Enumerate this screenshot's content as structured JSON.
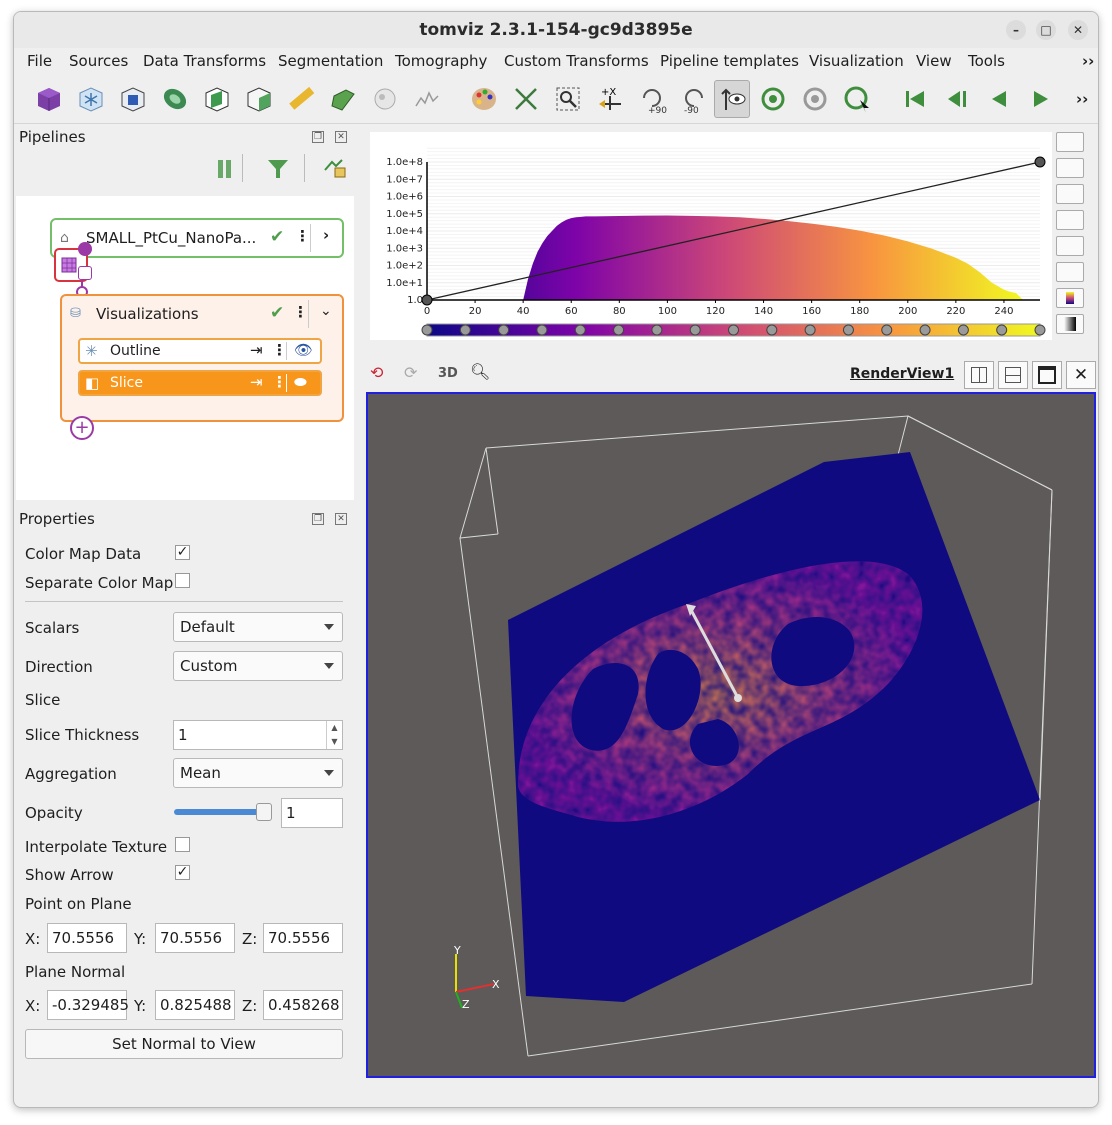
{
  "window": {
    "title": "tomviz 2.3.1-154-gc9d3895e"
  },
  "menu": [
    "File",
    "Sources",
    "Data Transforms",
    "Segmentation",
    "Tomography",
    "Custom Transforms",
    "Pipeline templates",
    "Visualization",
    "View",
    "Tools"
  ],
  "toolbar_icons": [
    "cube-icon",
    "snowflake-icon",
    "box-icon",
    "contour-icon",
    "slice-box-icon",
    "open-box-icon",
    "ruler-icon",
    "clip-icon",
    "sphere-icon",
    "line-plot-icon",
    "palette-icon",
    "fit-icon",
    "zoom-box-icon",
    "axis-x-icon",
    "rotate-cw-icon",
    "rotate-ccw-icon",
    "interact-icon",
    "reset-icon",
    "center-icon",
    "pick-icon",
    "first-frame-icon",
    "prev-frame-icon",
    "play-back-icon",
    "play-icon"
  ],
  "toolbar_labels": {
    "rot_pos": "+90",
    "rot_neg": "-90",
    "axis": "+X"
  },
  "pipelines": {
    "title": "Pipelines",
    "data_source": "SMALL_PtCu_NanoPa...",
    "visualizations_label": "Visualizations",
    "modules": [
      {
        "label": "Outline",
        "selected": false
      },
      {
        "label": "Slice",
        "selected": true
      }
    ]
  },
  "properties": {
    "title": "Properties",
    "color_map_data": {
      "label": "Color Map Data",
      "checked": true
    },
    "separate_color_map": {
      "label": "Separate Color Map",
      "checked": false
    },
    "scalars": {
      "label": "Scalars",
      "value": "Default"
    },
    "direction": {
      "label": "Direction",
      "value": "Custom"
    },
    "slice_label": "Slice",
    "slice_thickness": {
      "label": "Slice Thickness",
      "value": "1"
    },
    "aggregation": {
      "label": "Aggregation",
      "value": "Mean"
    },
    "opacity": {
      "label": "Opacity",
      "value": "1",
      "level": 1.0
    },
    "interpolate_texture": {
      "label": "Interpolate Texture",
      "checked": false
    },
    "show_arrow": {
      "label": "Show Arrow",
      "checked": true
    },
    "point_on_plane": {
      "label": "Point on Plane",
      "x": "70.5556",
      "y": "70.5556",
      "z": "70.5556"
    },
    "plane_normal": {
      "label": "Plane Normal",
      "x": "-0.329485",
      "y": "0.825488",
      "z": "0.458268"
    },
    "axis_labels": {
      "x": "X:",
      "y": "Y:",
      "z": "Z:"
    },
    "set_normal_button": "Set Normal to View"
  },
  "chart_data": {
    "type": "area",
    "y_scale": "log",
    "y_ticks": [
      "1.0",
      "1.0e+1",
      "1.0e+2",
      "1.0e+3",
      "1.0e+4",
      "1.0e+5",
      "1.0e+6",
      "1.0e+7",
      "1.0e+8"
    ],
    "x_ticks": [
      "0",
      "20",
      "40",
      "60",
      "80",
      "100",
      "120",
      "140",
      "160",
      "180",
      "200",
      "220",
      "240"
    ],
    "xlim": [
      0,
      255
    ],
    "ylim_log10": [
      0,
      8
    ],
    "x": [
      0,
      40,
      42,
      44,
      46,
      48,
      50,
      52,
      54,
      56,
      58,
      60,
      62,
      64,
      66,
      70,
      80,
      90,
      100,
      110,
      120,
      130,
      140,
      150,
      160,
      170,
      180,
      190,
      200,
      210,
      220,
      225,
      230,
      235,
      240,
      242,
      245,
      248
    ],
    "log10_counts": [
      0,
      0,
      1.2,
      2.1,
      2.8,
      3.3,
      3.7,
      4.0,
      4.3,
      4.5,
      4.65,
      4.75,
      4.8,
      4.82,
      4.85,
      4.85,
      4.87,
      4.89,
      4.9,
      4.88,
      4.85,
      4.8,
      4.7,
      4.58,
      4.43,
      4.25,
      4.02,
      3.75,
      3.4,
      2.98,
      2.45,
      2.1,
      1.6,
      1.0,
      0.6,
      0.5,
      0.4,
      0
    ],
    "opacity_line": [
      [
        0,
        0
      ],
      [
        255,
        8
      ]
    ],
    "colormap": "plasma",
    "colors": [
      "#0d0887",
      "#7e03a8",
      "#cc4778",
      "#f89540",
      "#f0f921"
    ]
  },
  "render_view": {
    "title": "RenderView1",
    "mode_label": "3D",
    "background": "#5d5a59",
    "axes": {
      "x": "X",
      "y": "Y",
      "z": "Z"
    }
  }
}
